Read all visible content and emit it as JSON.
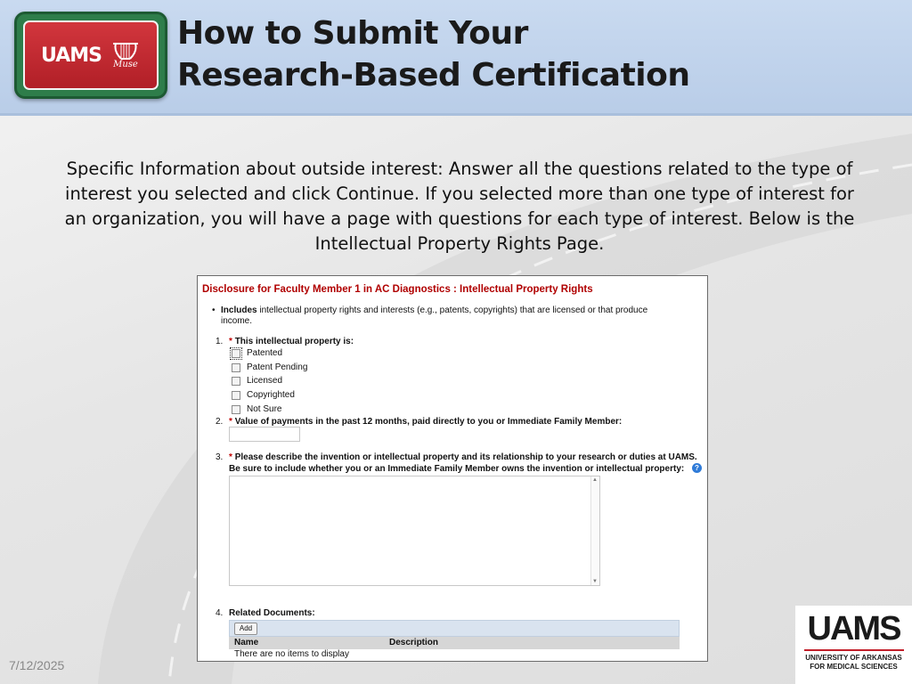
{
  "header": {
    "logo_text": "UAMS",
    "logo_mark_text": "Muse",
    "title_line1": "How to Submit Your",
    "title_line2": "Research-Based Certification"
  },
  "intro": {
    "line1": "Specific Information about outside interest:  Answer all the questions related to the type of",
    "line2": "interest you selected and click Continue.  If you selected more than one type of interest for",
    "line3": "an organization, you will have a page with questions for each type of interest.  Below is the",
    "line4": "Intellectual Property Rights Page."
  },
  "form": {
    "title": "Disclosure for Faculty Member 1  in AC Diagnostics : Intellectual Property Rights",
    "bullet_bold": "Includes",
    "bullet_rest_line1": " intellectual property rights and interests (e.g., patents, copyrights) that are licensed or that produce",
    "bullet_line2": "income.",
    "required_mark": "*",
    "q1": {
      "num": "1.",
      "label": "This intellectual property is:",
      "options": [
        "Patented",
        "Patent Pending",
        "Licensed",
        "Copyrighted",
        "Not Sure"
      ]
    },
    "q2": {
      "num": "2.",
      "label": "Value of payments in the past 12 months, paid directly to you or Immediate Family Member:"
    },
    "q3": {
      "num": "3.",
      "label_line1": "Please describe the invention or intellectual property and its relationship to your research or duties at UAMS.",
      "label_line2": "Be sure to include whether you or an Immediate Family Member owns the invention or intellectual property:",
      "help_icon": "?"
    },
    "q4": {
      "num": "4.",
      "label": "Related Documents:",
      "add_label": "Add",
      "columns": [
        "Name",
        "Description"
      ],
      "empty_text": "There are no items to display"
    }
  },
  "footer": {
    "date": "7/12/2025",
    "corner_logo_text": "UAMS",
    "corner_sub_line1": "UNIVERSITY OF ARKANSAS",
    "corner_sub_line2": "FOR MEDICAL SCIENCES"
  },
  "colors": {
    "header_band": "#c9daf0",
    "form_title": "#b00000",
    "logo_red": "#b11f27",
    "logo_green": "#2e7d4a"
  }
}
